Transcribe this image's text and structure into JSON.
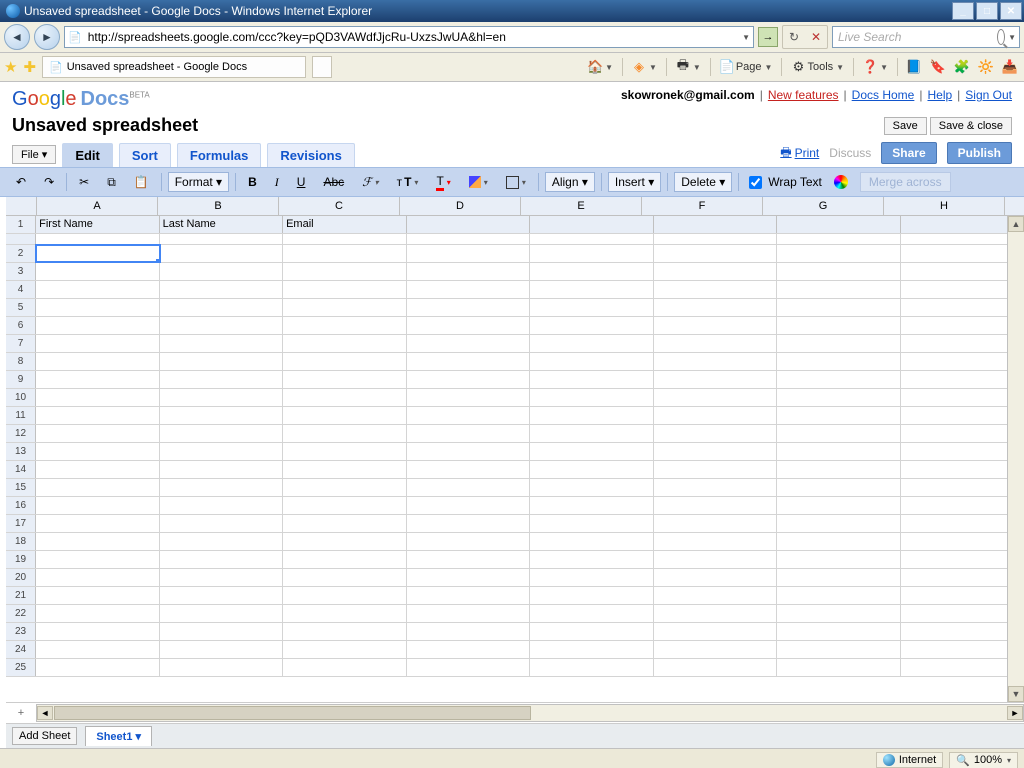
{
  "window": {
    "title": "Unsaved spreadsheet - Google Docs - Windows Internet Explorer"
  },
  "ie": {
    "url": "http://spreadsheets.google.com/ccc?key=pQD3VAWdfJjcRu-UxzsJwUA&hl=en",
    "search_placeholder": "Live Search",
    "tab_title": "Unsaved spreadsheet - Google Docs",
    "toolbar": {
      "page": "Page",
      "tools": "Tools"
    }
  },
  "gd": {
    "header": {
      "email": "skowronek@gmail.com",
      "new_features": "New features",
      "docs_home": "Docs Home",
      "help": "Help",
      "sign_out": "Sign Out"
    },
    "title": "Unsaved spreadsheet",
    "save": "Save",
    "save_close": "Save & close",
    "file_menu": "File ▾",
    "tabs": {
      "edit": "Edit",
      "sort": "Sort",
      "formulas": "Formulas",
      "revisions": "Revisions"
    },
    "right_actions": {
      "print": "Print",
      "discuss": "Discuss",
      "share": "Share",
      "publish": "Publish"
    },
    "fmt": {
      "format": "Format ▾",
      "align": "Align ▾",
      "insert": "Insert ▾",
      "delete": "Delete ▾",
      "wrap": "Wrap Text",
      "merge": "Merge across"
    },
    "columns": [
      "A",
      "B",
      "C",
      "D",
      "E",
      "F",
      "G",
      "H"
    ],
    "rows": 25,
    "data": {
      "1": {
        "A": "First Name",
        "B": "Last Name",
        "C": "Email"
      }
    },
    "selected_cell": "A2",
    "sheet": {
      "add": "Add Sheet",
      "tab1": "Sheet1 ▾"
    }
  },
  "status": {
    "zone": "Internet",
    "zoom": "100%"
  }
}
